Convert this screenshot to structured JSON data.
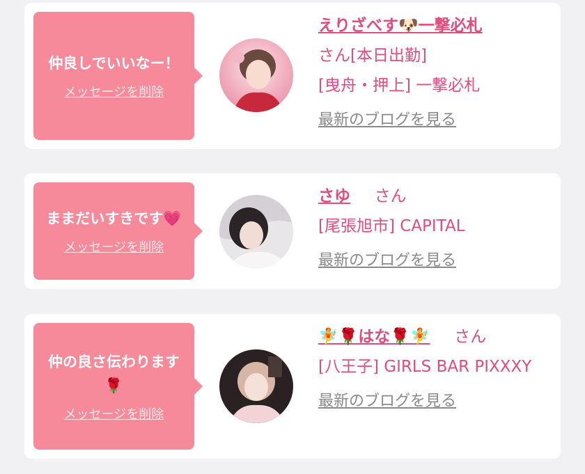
{
  "messages": [
    {
      "bubble_text": "仲良しでいいなー！",
      "delete_label": "メッセージを削除",
      "name": "えりざべす🐶一撃必札",
      "suffix": "さん[本日出勤]",
      "shop": "[曳舟・押上] 一撃必札",
      "blog_label": "最新のブログを見る"
    },
    {
      "bubble_text": "ままだいすきです💗",
      "delete_label": "メッセージを削除",
      "name": "さゆ",
      "suffix": "さん",
      "shop": "[尾張旭市] CAPITAL",
      "blog_label": "最新のブログを見る"
    },
    {
      "bubble_text": "仲の良さ伝わります🌹",
      "delete_label": "メッセージを削除",
      "name": "🧚🌹はな🌹🧚",
      "suffix": "さん",
      "shop": "[八王子] GIRLS BAR PIXXXY",
      "blog_label": "最新のブログを見る"
    }
  ],
  "colors": {
    "bubble": "#f6899a",
    "accent": "#e04d7d",
    "link_gray": "#8a8a8a",
    "background": "#f1f1f3"
  }
}
